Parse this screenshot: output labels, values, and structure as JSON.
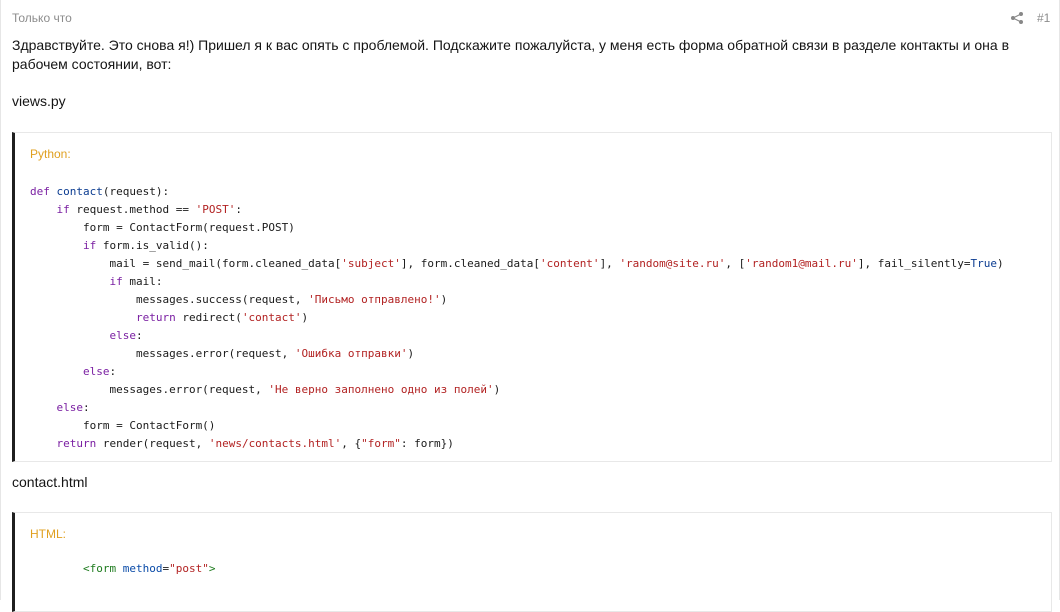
{
  "post": {
    "time": "Только что",
    "number": "#1",
    "share_icon": "share-icon",
    "intro": "Здравствуйте. Это снова я!) Пришел я к вас опять с проблемой. Подскажите пожалуйста, у меня есть форма обратной связи в разделе контакты и она в рабочем состоянии, вот:",
    "file1": "views.py",
    "file2": "contact.html"
  },
  "code_blocks": [
    {
      "language": "Python:",
      "lines": [
        [
          {
            "t": "def ",
            "c": "kw"
          },
          {
            "t": "contact",
            "c": "kw2"
          },
          {
            "t": "(request):",
            "c": ""
          }
        ],
        [
          {
            "t": "    ",
            "c": ""
          },
          {
            "t": "if ",
            "c": "kw"
          },
          {
            "t": "request.method == ",
            "c": ""
          },
          {
            "t": "'POST'",
            "c": "str"
          },
          {
            "t": ":",
            "c": ""
          }
        ],
        [
          {
            "t": "        form = ContactForm(request.POST)",
            "c": ""
          }
        ],
        [
          {
            "t": "        ",
            "c": ""
          },
          {
            "t": "if ",
            "c": "kw"
          },
          {
            "t": "form.is_valid():",
            "c": ""
          }
        ],
        [
          {
            "t": "            mail = send_mail(form.cleaned_data[",
            "c": ""
          },
          {
            "t": "'subject'",
            "c": "str"
          },
          {
            "t": "], form.cleaned_data[",
            "c": ""
          },
          {
            "t": "'content'",
            "c": "str"
          },
          {
            "t": "], ",
            "c": ""
          },
          {
            "t": "'random@site.ru'",
            "c": "str"
          },
          {
            "t": ", [",
            "c": ""
          },
          {
            "t": "'random1@mail.ru'",
            "c": "str"
          },
          {
            "t": "], fail_silently=",
            "c": ""
          },
          {
            "t": "True",
            "c": "kw2"
          },
          {
            "t": ")",
            "c": ""
          }
        ],
        [
          {
            "t": "            ",
            "c": ""
          },
          {
            "t": "if ",
            "c": "kw"
          },
          {
            "t": "mail:",
            "c": ""
          }
        ],
        [
          {
            "t": "                messages.success(request, ",
            "c": ""
          },
          {
            "t": "'Письмо отправлено!'",
            "c": "str"
          },
          {
            "t": ")",
            "c": ""
          }
        ],
        [
          {
            "t": "                ",
            "c": ""
          },
          {
            "t": "return ",
            "c": "kw"
          },
          {
            "t": "redirect(",
            "c": ""
          },
          {
            "t": "'contact'",
            "c": "str"
          },
          {
            "t": ")",
            "c": ""
          }
        ],
        [
          {
            "t": "            ",
            "c": ""
          },
          {
            "t": "else",
            "c": "kw"
          },
          {
            "t": ":",
            "c": ""
          }
        ],
        [
          {
            "t": "                messages.error(request, ",
            "c": ""
          },
          {
            "t": "'Ошибка отправки'",
            "c": "str"
          },
          {
            "t": ")",
            "c": ""
          }
        ],
        [
          {
            "t": "        ",
            "c": ""
          },
          {
            "t": "else",
            "c": "kw"
          },
          {
            "t": ":",
            "c": ""
          }
        ],
        [
          {
            "t": "            messages.error(request, ",
            "c": ""
          },
          {
            "t": "'Не верно заполнено одно из полей'",
            "c": "str"
          },
          {
            "t": ")",
            "c": ""
          }
        ],
        [
          {
            "t": "    ",
            "c": ""
          },
          {
            "t": "else",
            "c": "kw"
          },
          {
            "t": ":",
            "c": ""
          }
        ],
        [
          {
            "t": "        form = ContactForm()",
            "c": ""
          }
        ],
        [
          {
            "t": "    ",
            "c": ""
          },
          {
            "t": "return ",
            "c": "kw"
          },
          {
            "t": "render(request, ",
            "c": ""
          },
          {
            "t": "'news/contacts.html'",
            "c": "str"
          },
          {
            "t": ", {",
            "c": ""
          },
          {
            "t": "\"form\"",
            "c": "str"
          },
          {
            "t": ": form})",
            "c": ""
          }
        ]
      ]
    },
    {
      "language": "HTML:",
      "lines": [
        [
          {
            "t": "        ",
            "c": ""
          },
          {
            "t": "<form ",
            "c": "tag"
          },
          {
            "t": "method",
            "c": "attr"
          },
          {
            "t": "=",
            "c": ""
          },
          {
            "t": "\"post\"",
            "c": "str"
          },
          {
            "t": ">",
            "c": "tag"
          }
        ]
      ]
    }
  ],
  "colors": {
    "language_label": "#e0a020",
    "keyword": "#7a1fa2",
    "string": "#b22222",
    "tag": "#1e7b1e",
    "attribute": "#0a4ba8"
  }
}
